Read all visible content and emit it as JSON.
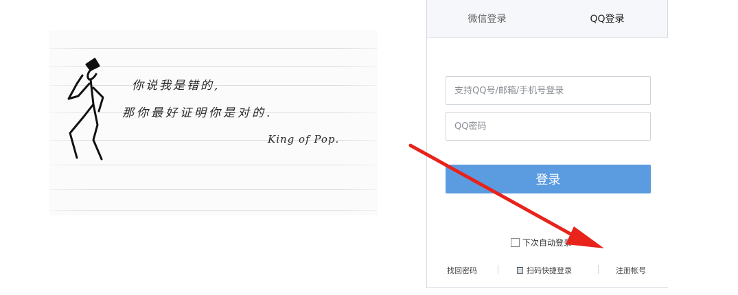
{
  "illustration": {
    "line1": "你说我是错的,",
    "line2": "那你最好证明你是对的.",
    "signature": "King of Pop."
  },
  "login": {
    "tabs": [
      {
        "label": "微信登录",
        "active": false
      },
      {
        "label": "QQ登录",
        "active": true
      }
    ],
    "account_placeholder": "支持QQ号/邮箱/手机号登录",
    "password_placeholder": "QQ密码",
    "submit_label": "登录",
    "remember_label": "下次自动登录",
    "remember_checked": false,
    "links": {
      "recover": "找回密码",
      "qr_login": "扫码快捷登录",
      "register": "注册帐号"
    }
  },
  "annotation": {
    "arrow_color": "#e8231c",
    "primary_color": "#5b9be0"
  }
}
